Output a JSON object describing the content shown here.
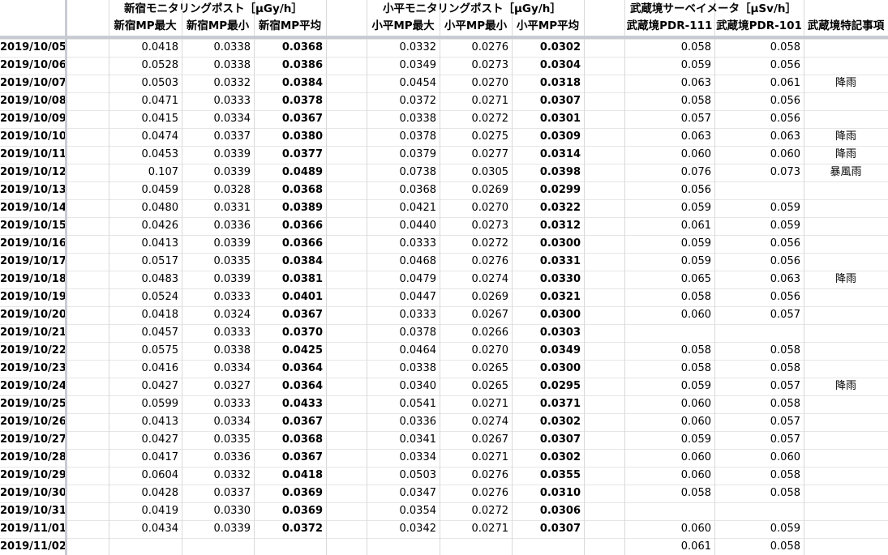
{
  "group_headers": {
    "shinjuku": "新宿モニタリングポスト［μGy/h］",
    "kodaira": "小平モニタリングポスト［μGy/h］",
    "musashisakai": "武蔵境サーベイメータ［μSv/h］"
  },
  "column_headers": [
    "新宿MP最大",
    "新宿MP最小",
    "新宿MP平均",
    "小平MP最大",
    "小平MP最小",
    "小平MP平均",
    "武蔵境PDR-111",
    "武蔵境PDR-101",
    "武蔵境特記事項"
  ],
  "rows": [
    {
      "date": "2019/10/05",
      "s_max": "0.0418",
      "s_min": "0.0338",
      "s_avg": "0.0368",
      "k_max": "0.0332",
      "k_min": "0.0276",
      "k_avg": "0.0302",
      "p111": "0.058",
      "p101": "0.058",
      "note": ""
    },
    {
      "date": "2019/10/06",
      "s_max": "0.0528",
      "s_min": "0.0338",
      "s_avg": "0.0386",
      "k_max": "0.0349",
      "k_min": "0.0273",
      "k_avg": "0.0304",
      "p111": "0.059",
      "p101": "0.056",
      "note": ""
    },
    {
      "date": "2019/10/07",
      "s_max": "0.0503",
      "s_min": "0.0332",
      "s_avg": "0.0384",
      "k_max": "0.0454",
      "k_min": "0.0270",
      "k_avg": "0.0318",
      "p111": "0.063",
      "p101": "0.061",
      "note": "降雨"
    },
    {
      "date": "2019/10/08",
      "s_max": "0.0471",
      "s_min": "0.0333",
      "s_avg": "0.0378",
      "k_max": "0.0372",
      "k_min": "0.0271",
      "k_avg": "0.0307",
      "p111": "0.058",
      "p101": "0.056",
      "note": ""
    },
    {
      "date": "2019/10/09",
      "s_max": "0.0415",
      "s_min": "0.0334",
      "s_avg": "0.0367",
      "k_max": "0.0338",
      "k_min": "0.0272",
      "k_avg": "0.0301",
      "p111": "0.057",
      "p101": "0.056",
      "note": ""
    },
    {
      "date": "2019/10/10",
      "s_max": "0.0474",
      "s_min": "0.0337",
      "s_avg": "0.0380",
      "k_max": "0.0378",
      "k_min": "0.0275",
      "k_avg": "0.0309",
      "p111": "0.063",
      "p101": "0.063",
      "note": "降雨"
    },
    {
      "date": "2019/10/11",
      "s_max": "0.0453",
      "s_min": "0.0339",
      "s_avg": "0.0377",
      "k_max": "0.0379",
      "k_min": "0.0277",
      "k_avg": "0.0314",
      "p111": "0.060",
      "p101": "0.060",
      "note": "降雨"
    },
    {
      "date": "2019/10/12",
      "s_max": "0.107",
      "s_min": "0.0339",
      "s_avg": "0.0489",
      "k_max": "0.0738",
      "k_min": "0.0305",
      "k_avg": "0.0398",
      "p111": "0.076",
      "p101": "0.073",
      "note": "暴風雨"
    },
    {
      "date": "2019/10/13",
      "s_max": "0.0459",
      "s_min": "0.0328",
      "s_avg": "0.0368",
      "k_max": "0.0368",
      "k_min": "0.0269",
      "k_avg": "0.0299",
      "p111": "0.056",
      "p101": "",
      "note": ""
    },
    {
      "date": "2019/10/14",
      "s_max": "0.0480",
      "s_min": "0.0331",
      "s_avg": "0.0389",
      "k_max": "0.0421",
      "k_min": "0.0270",
      "k_avg": "0.0322",
      "p111": "0.059",
      "p101": "0.059",
      "note": ""
    },
    {
      "date": "2019/10/15",
      "s_max": "0.0426",
      "s_min": "0.0336",
      "s_avg": "0.0366",
      "k_max": "0.0440",
      "k_min": "0.0273",
      "k_avg": "0.0312",
      "p111": "0.061",
      "p101": "0.059",
      "note": ""
    },
    {
      "date": "2019/10/16",
      "s_max": "0.0413",
      "s_min": "0.0339",
      "s_avg": "0.0366",
      "k_max": "0.0333",
      "k_min": "0.0272",
      "k_avg": "0.0300",
      "p111": "0.059",
      "p101": "0.056",
      "note": ""
    },
    {
      "date": "2019/10/17",
      "s_max": "0.0517",
      "s_min": "0.0335",
      "s_avg": "0.0384",
      "k_max": "0.0468",
      "k_min": "0.0276",
      "k_avg": "0.0331",
      "p111": "0.059",
      "p101": "0.056",
      "note": ""
    },
    {
      "date": "2019/10/18",
      "s_max": "0.0483",
      "s_min": "0.0339",
      "s_avg": "0.0381",
      "k_max": "0.0479",
      "k_min": "0.0274",
      "k_avg": "0.0330",
      "p111": "0.065",
      "p101": "0.063",
      "note": "降雨"
    },
    {
      "date": "2019/10/19",
      "s_max": "0.0524",
      "s_min": "0.0333",
      "s_avg": "0.0401",
      "k_max": "0.0447",
      "k_min": "0.0269",
      "k_avg": "0.0321",
      "p111": "0.058",
      "p101": "0.056",
      "note": ""
    },
    {
      "date": "2019/10/20",
      "s_max": "0.0418",
      "s_min": "0.0324",
      "s_avg": "0.0367",
      "k_max": "0.0333",
      "k_min": "0.0267",
      "k_avg": "0.0300",
      "p111": "0.060",
      "p101": "0.057",
      "note": ""
    },
    {
      "date": "2019/10/21",
      "s_max": "0.0457",
      "s_min": "0.0333",
      "s_avg": "0.0370",
      "k_max": "0.0378",
      "k_min": "0.0266",
      "k_avg": "0.0303",
      "p111": "",
      "p101": "",
      "note": ""
    },
    {
      "date": "2019/10/22",
      "s_max": "0.0575",
      "s_min": "0.0338",
      "s_avg": "0.0425",
      "k_max": "0.0464",
      "k_min": "0.0270",
      "k_avg": "0.0349",
      "p111": "0.058",
      "p101": "0.058",
      "note": ""
    },
    {
      "date": "2019/10/23",
      "s_max": "0.0416",
      "s_min": "0.0334",
      "s_avg": "0.0364",
      "k_max": "0.0338",
      "k_min": "0.0265",
      "k_avg": "0.0300",
      "p111": "0.058",
      "p101": "0.058",
      "note": ""
    },
    {
      "date": "2019/10/24",
      "s_max": "0.0427",
      "s_min": "0.0327",
      "s_avg": "0.0364",
      "k_max": "0.0340",
      "k_min": "0.0265",
      "k_avg": "0.0295",
      "p111": "0.059",
      "p101": "0.057",
      "note": "降雨"
    },
    {
      "date": "2019/10/25",
      "s_max": "0.0599",
      "s_min": "0.0333",
      "s_avg": "0.0433",
      "k_max": "0.0541",
      "k_min": "0.0271",
      "k_avg": "0.0371",
      "p111": "0.060",
      "p101": "0.058",
      "note": ""
    },
    {
      "date": "2019/10/26",
      "s_max": "0.0413",
      "s_min": "0.0334",
      "s_avg": "0.0367",
      "k_max": "0.0336",
      "k_min": "0.0274",
      "k_avg": "0.0302",
      "p111": "0.060",
      "p101": "0.057",
      "note": ""
    },
    {
      "date": "2019/10/27",
      "s_max": "0.0427",
      "s_min": "0.0335",
      "s_avg": "0.0368",
      "k_max": "0.0341",
      "k_min": "0.0267",
      "k_avg": "0.0307",
      "p111": "0.059",
      "p101": "0.057",
      "note": ""
    },
    {
      "date": "2019/10/28",
      "s_max": "0.0417",
      "s_min": "0.0336",
      "s_avg": "0.0367",
      "k_max": "0.0334",
      "k_min": "0.0271",
      "k_avg": "0.0302",
      "p111": "0.060",
      "p101": "0.060",
      "note": ""
    },
    {
      "date": "2019/10/29",
      "s_max": "0.0604",
      "s_min": "0.0332",
      "s_avg": "0.0418",
      "k_max": "0.0503",
      "k_min": "0.0276",
      "k_avg": "0.0355",
      "p111": "0.060",
      "p101": "0.058",
      "note": ""
    },
    {
      "date": "2019/10/30",
      "s_max": "0.0428",
      "s_min": "0.0337",
      "s_avg": "0.0369",
      "k_max": "0.0347",
      "k_min": "0.0276",
      "k_avg": "0.0310",
      "p111": "0.058",
      "p101": "0.058",
      "note": ""
    },
    {
      "date": "2019/10/31",
      "s_max": "0.0419",
      "s_min": "0.0330",
      "s_avg": "0.0369",
      "k_max": "0.0354",
      "k_min": "0.0272",
      "k_avg": "0.0306",
      "p111": "",
      "p101": "",
      "note": ""
    },
    {
      "date": "2019/11/01",
      "s_max": "0.0434",
      "s_min": "0.0339",
      "s_avg": "0.0372",
      "k_max": "0.0342",
      "k_min": "0.0271",
      "k_avg": "0.0307",
      "p111": "0.060",
      "p101": "0.059",
      "note": ""
    },
    {
      "date": "2019/11/02",
      "s_max": "",
      "s_min": "",
      "s_avg": "",
      "k_max": "",
      "k_min": "",
      "k_avg": "",
      "p111": "0.061",
      "p101": "0.058",
      "note": ""
    }
  ]
}
